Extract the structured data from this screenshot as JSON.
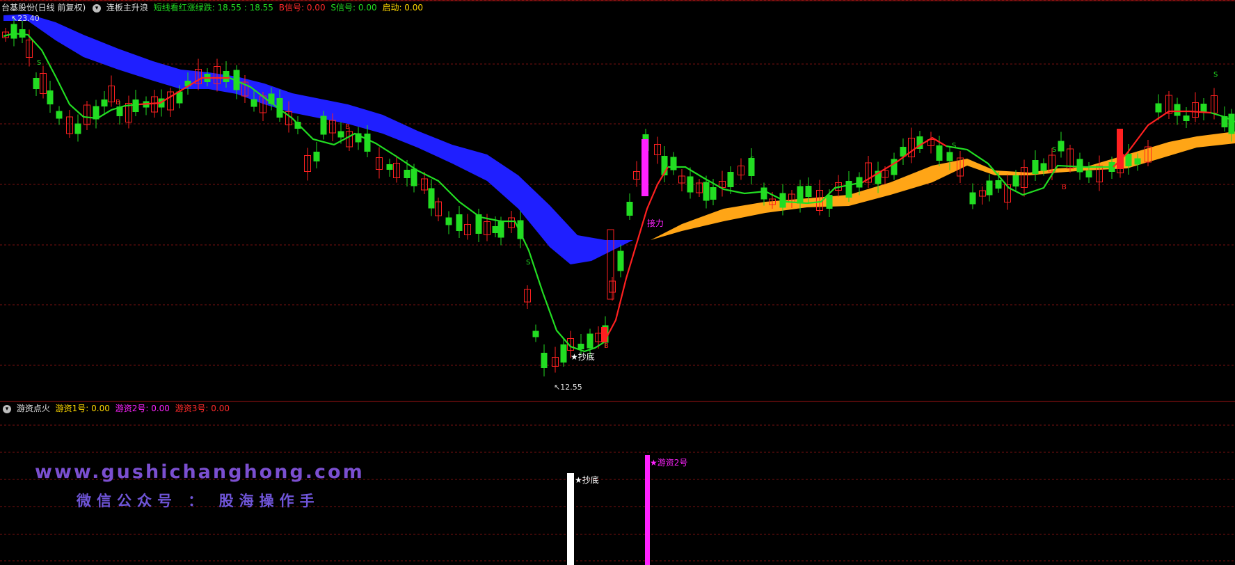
{
  "main_header": {
    "title": "台基股份(日线 前复权)",
    "indicator": "连板主升浪",
    "items": [
      {
        "label": "短线看红涨绿跌: 18.55 : 18.55",
        "color": "#22dd22"
      },
      {
        "label": "B信号: 0.00",
        "color": "#ff2a2a"
      },
      {
        "label": "S信号: 0.00",
        "color": "#22dd22"
      },
      {
        "label": "启动: 0.00",
        "color": "#ffd800"
      }
    ]
  },
  "sub_header": {
    "indicator": "游资点火",
    "items": [
      {
        "label": "游资1号: 0.00",
        "color": "#ffd800"
      },
      {
        "label": "游资2号: 0.00",
        "color": "#ff22ff"
      },
      {
        "label": "游资3号: 0.00",
        "color": "#ff2a2a"
      }
    ]
  },
  "annotations": {
    "high_label": "23.40",
    "low_label": "12.55",
    "bottom_signal": "★抄底",
    "relay_signal": "接力",
    "sub_bottom_signal": "★抄底",
    "sub_relay_signal": "★游资2号",
    "s_marker": "S",
    "b_marker": "B"
  },
  "watermark": {
    "url": "www.gushichanghong.com",
    "wechat": "微信公众号 ： 股海操作手"
  },
  "colors": {
    "up": "#ff2020",
    "down": "#22dd22",
    "ribbon_down": "#1f1fff",
    "ribbon_up": "#ffa516",
    "line_green": "#22dd22",
    "line_red": "#ff2020",
    "magenta": "#ff22ff",
    "grid": "#7a1010"
  },
  "chart_data": {
    "type": "candlestick",
    "price_high": 23.4,
    "price_low": 12.55,
    "sub_bars": [
      {
        "name": "抄底",
        "value": 1
      },
      {
        "name": "游资2号",
        "value": 1
      }
    ]
  }
}
